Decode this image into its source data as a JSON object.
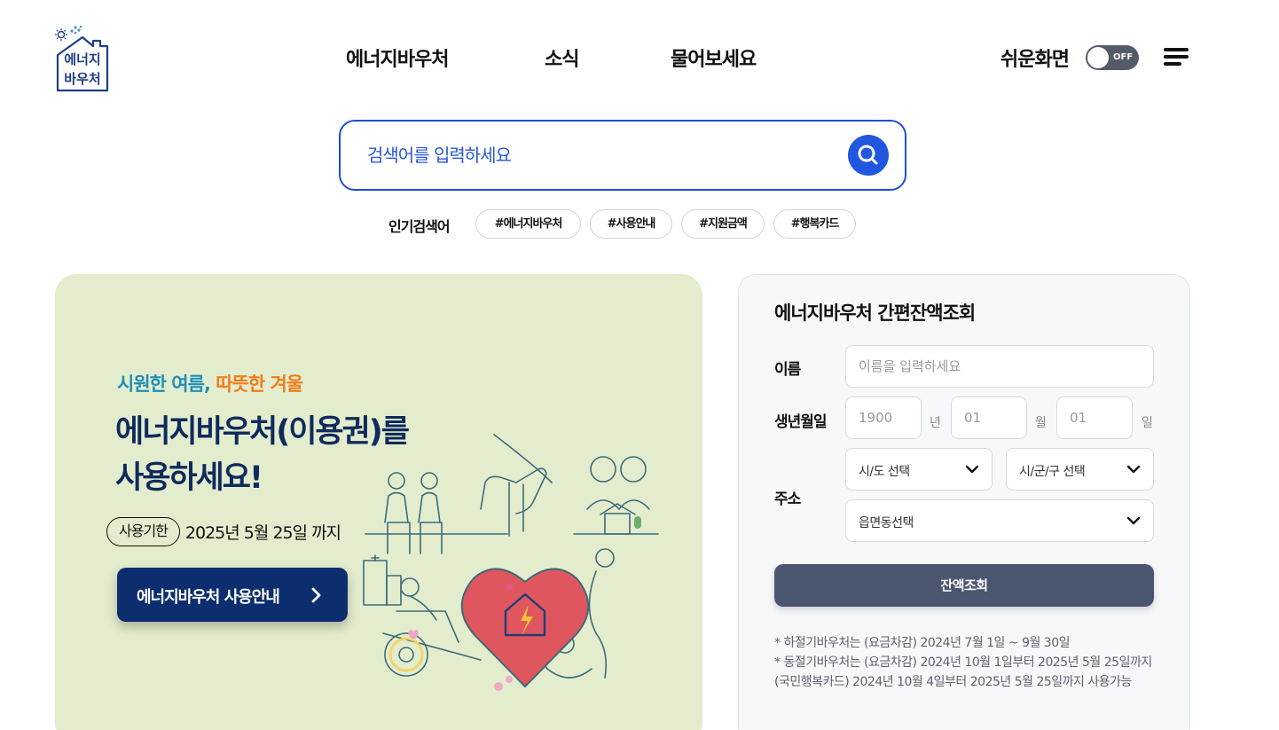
{
  "logo": {
    "line1": "에너지",
    "line2": "바우처"
  },
  "nav": {
    "items": [
      {
        "label": "에너지바우처"
      },
      {
        "label": "소식"
      },
      {
        "label": "물어보세요"
      }
    ]
  },
  "accessibility": {
    "label": "쉬운화면",
    "toggle_text": "OFF",
    "toggle_state": "off"
  },
  "search": {
    "placeholder": "검색어를 입력하세요"
  },
  "popular": {
    "label": "인기검색어",
    "tags": [
      "#에너지바우처",
      "#사용안내",
      "#지원금액",
      "#행복카드"
    ]
  },
  "banner": {
    "subtitle_part1": "시원한 여름,",
    "subtitle_part2": "따뜻한 겨울",
    "title_line1": "에너지바우처(이용권)를",
    "title_line2": "사용하세요!",
    "period_badge": "사용기한",
    "period_date": "2025년 5월 25일 까지",
    "button_label": "에너지바우처 사용안내",
    "colors": {
      "background": "#e3edcd",
      "title": "#0f2a5c",
      "subtitle_cool": "#1f8fb8",
      "subtitle_warm": "#ef7d1a",
      "button": "#0d2e6e"
    }
  },
  "balance": {
    "title": "에너지바우처 간편잔액조회",
    "name_label": "이름",
    "name_placeholder": "이름을 입력하세요",
    "birth_label": "생년월일",
    "birth_year_placeholder": "1900",
    "birth_year_unit": "년",
    "birth_month_placeholder": "01",
    "birth_month_unit": "월",
    "birth_day_placeholder": "01",
    "birth_day_unit": "일",
    "address_label": "주소",
    "sido_placeholder": "시/도 선택",
    "sigungu_placeholder": "시/군/구 선택",
    "eupmyeondong_placeholder": "읍면동선택",
    "submit_label": "잔액조회",
    "notes": [
      "* 하절기바우처는 (요금차감) 2024년 7월 1일 ~ 9월 30일",
      "* 동절기바우처는 (요금차감) 2024년 10월 1일부터 2025년 5월 25일까지 (국민행복카드) 2024년 10월 4일부터 2025년 5월 25일까지 사용가능"
    ]
  },
  "icons": {
    "logo": "house-logo-icon",
    "search": "search-icon",
    "menu": "hamburger-menu-icon",
    "chevron": "chevron-right-icon",
    "dropdown": "chevron-down-icon",
    "illustration": "heart-house-community-icon"
  },
  "theme": {
    "accent": "#1f4fd1",
    "search_button": "#2157e0",
    "submit_button": "#4a5670",
    "toggle": "#555b66"
  }
}
